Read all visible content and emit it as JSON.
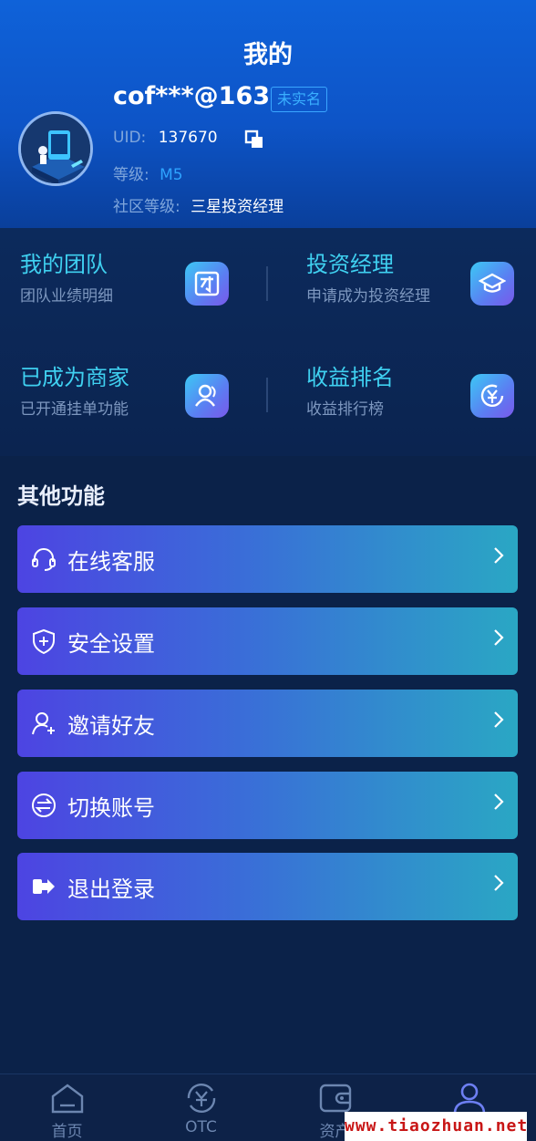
{
  "header": {
    "title": "我的",
    "username": "cof***@163",
    "real_name_badge": "未实名",
    "uid_label": "UID:",
    "uid_value": "137670",
    "level_label": "等级:",
    "level_value": "M5",
    "community_label": "社区等级:",
    "community_value": "三星投资经理"
  },
  "features": [
    {
      "title": "我的团队",
      "subtitle": "团队业绩明细",
      "icon": "team-icon"
    },
    {
      "title": "投资经理",
      "subtitle": "申请成为投资经理",
      "icon": "graduation-cap-icon"
    },
    {
      "title": "已成为商家",
      "subtitle": "已开通挂单功能",
      "icon": "merchant-users-icon"
    },
    {
      "title": "收益排名",
      "subtitle": "收益排行榜",
      "icon": "yuan-ranking-icon"
    }
  ],
  "other": {
    "title": "其他功能",
    "items": [
      {
        "label": "在线客服",
        "icon": "headset-icon"
      },
      {
        "label": "安全设置",
        "icon": "shield-plus-icon"
      },
      {
        "label": "邀请好友",
        "icon": "user-add-icon"
      },
      {
        "label": "切换账号",
        "icon": "switch-arrows-icon"
      },
      {
        "label": "退出登录",
        "icon": "logout-icon"
      }
    ]
  },
  "tabbar": {
    "items": [
      {
        "label": "首页",
        "icon": "home-icon"
      },
      {
        "label": "OTC",
        "icon": "yuan-exchange-icon"
      },
      {
        "label": "资产",
        "icon": "wallet-icon"
      },
      {
        "label": "",
        "icon": "user-icon",
        "active": true
      }
    ]
  },
  "watermark": "www.tiaozhuan.net",
  "colors": {
    "header_top": "#0f62d9",
    "background": "#0b2249",
    "feature_title": "#3fd0f0",
    "menu_gradient_start": "#4d44e2",
    "menu_gradient_end": "#2aa7c4",
    "tab_active": "#6d7ff2"
  }
}
